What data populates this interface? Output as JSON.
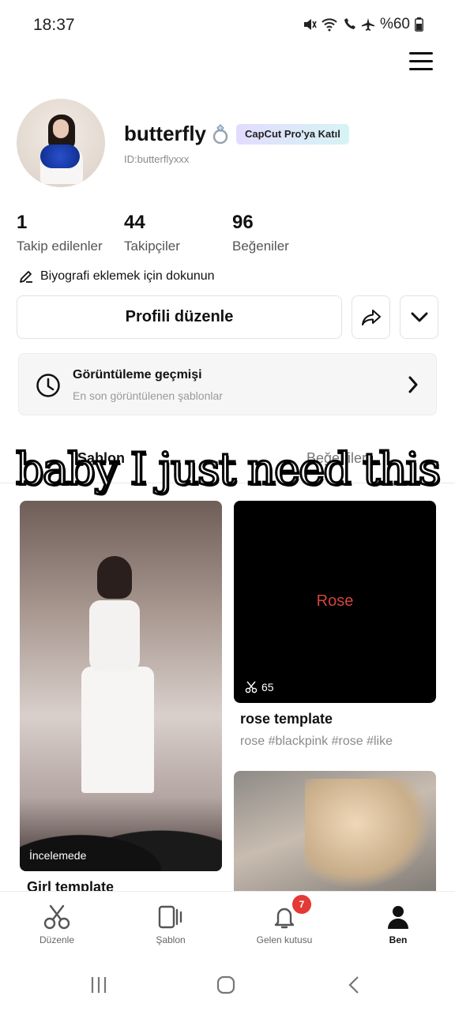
{
  "status_bar": {
    "time": "18:37",
    "battery": "%60",
    "icons": [
      "mute-icon",
      "wifi-icon",
      "wifi-call-icon",
      "airplane-icon",
      "battery-icon"
    ]
  },
  "header": {
    "menu_icon": "hamburger-menu-icon"
  },
  "profile": {
    "username": "butterfly",
    "username_emoji": "ring-icon",
    "pro_badge": "CapCut Pro'ya Katıl",
    "user_id": "ID:butterflyxxx"
  },
  "stats": [
    {
      "value": "1",
      "label": "Takip edilenler"
    },
    {
      "value": "44",
      "label": "Takipçiler"
    },
    {
      "value": "96",
      "label": "Beğeniler"
    }
  ],
  "bio_prompt": "Biyografi eklemek için dokunun",
  "actions": {
    "edit_profile": "Profili düzenle",
    "share_icon": "share-icon",
    "more_icon": "chevron-down-icon"
  },
  "history": {
    "title": "Görüntüleme geçmişi",
    "subtitle": "En son görüntülenen şablonlar"
  },
  "tabs": [
    {
      "label": "Şablon",
      "active": true
    },
    {
      "label": "Beğeniler",
      "active": false
    }
  ],
  "overlay_caption": "baby I just need this",
  "cards": [
    {
      "badge": "İncelemede",
      "title": "Girl template"
    },
    {
      "thumb_text": "Rose",
      "uses": "65",
      "title": "rose template",
      "tags": "rose #blackpink #rose #like"
    }
  ],
  "bottom_nav": [
    {
      "label": "Düzenle",
      "icon": "scissors-icon",
      "active": false
    },
    {
      "label": "Şablon",
      "icon": "template-icon",
      "active": false
    },
    {
      "label": "Gelen kutusu",
      "icon": "bell-icon",
      "active": false,
      "badge": "7"
    },
    {
      "label": "Ben",
      "icon": "person-icon",
      "active": true
    }
  ],
  "colors": {
    "accent_red": "#e53935",
    "rose_text": "#d0453a",
    "badge_gradient_start": "#e2dcff",
    "badge_gradient_end": "#d6f4f4"
  }
}
